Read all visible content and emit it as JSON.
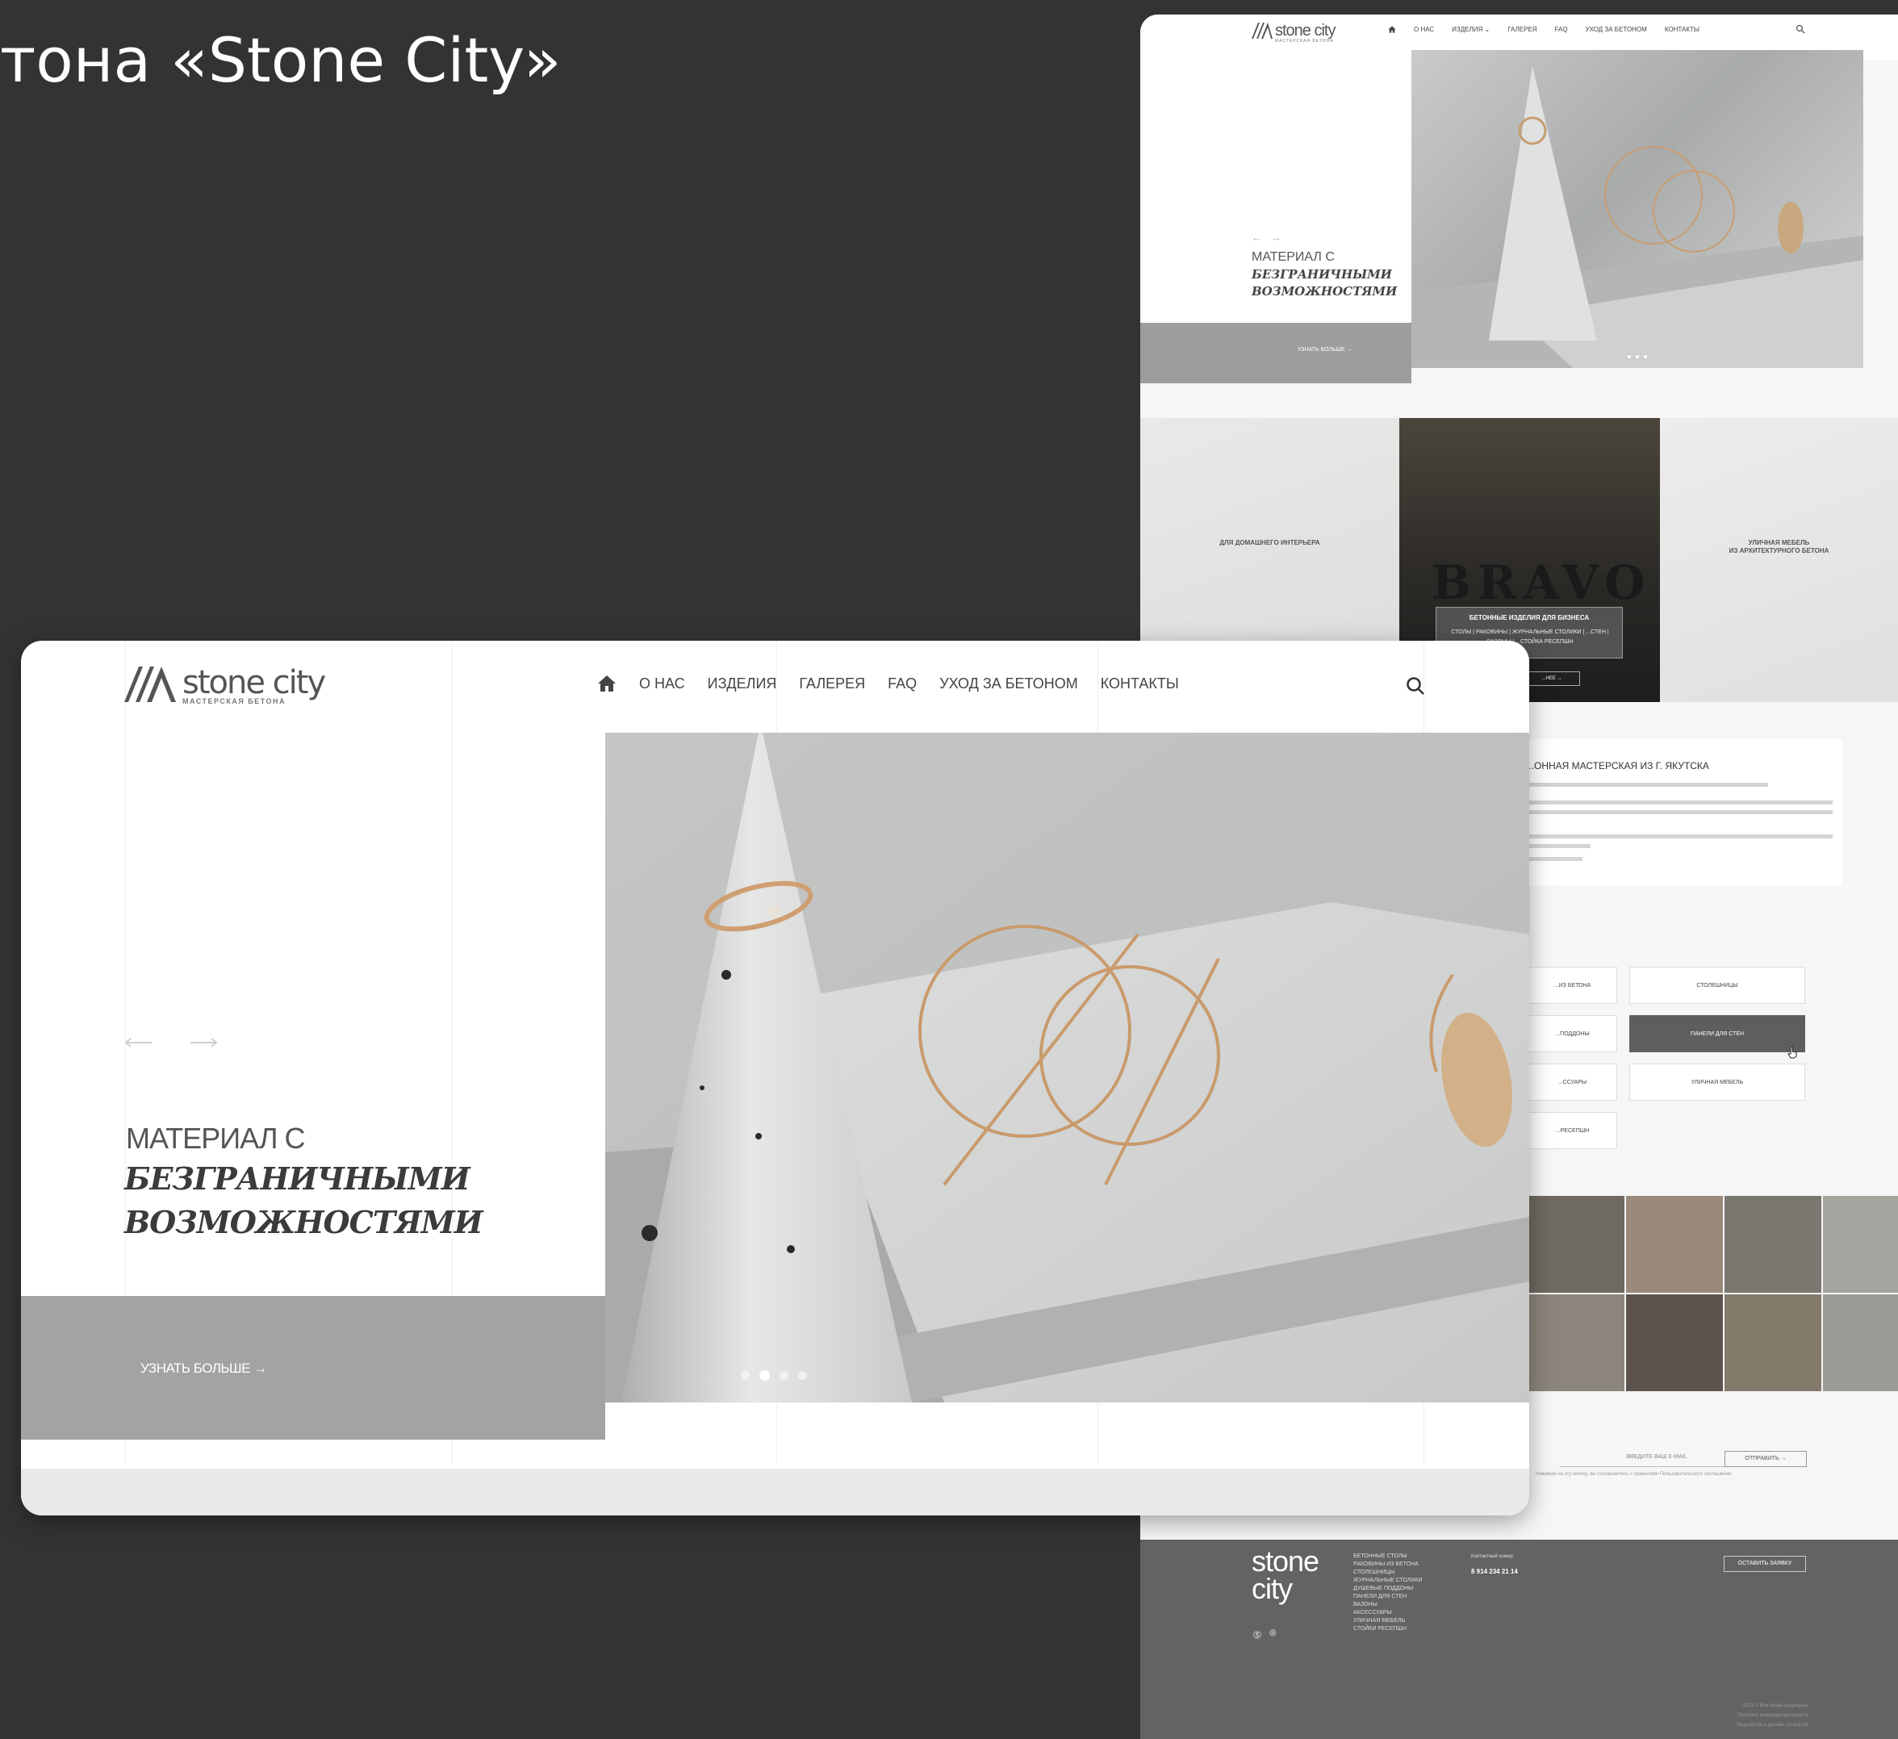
{
  "page_heading": "тона «Stone City»",
  "front": {
    "logo": {
      "name": "stone city",
      "tagline": "МАСТЕРСКАЯ БЕТОНА"
    },
    "nav": [
      {
        "label": "О НАС"
      },
      {
        "label": "ИЗДЕЛИЯ"
      },
      {
        "label": "ГАЛЕРЕЯ"
      },
      {
        "label": "FAQ"
      },
      {
        "label": "УХОД ЗА БЕТОНОМ"
      },
      {
        "label": "КОНТАКТЫ"
      }
    ],
    "hero": {
      "line1": "МАТЕРИАЛ С",
      "line2": "БЕЗГРАНИЧНЫМИ",
      "line3": "ВОЗМОЖНОСТЯМИ",
      "cta": "УЗНАТЬ БОЛЬШЕ →",
      "slides_total": 4,
      "active_slide": 2
    }
  },
  "background_page": {
    "logo": {
      "name": "stone city",
      "tagline": "МАСТЕРСКАЯ БЕТОНА"
    },
    "nav": [
      "О НАС",
      "ИЗДЕЛИЯ ⌄",
      "ГАЛЕРЕЯ",
      "FAQ",
      "УХОД ЗА БЕТОНОМ",
      "КОНТАКТЫ"
    ],
    "hero": {
      "line1": "МАТЕРИАЛ С",
      "line2": "БЕЗГРАНИЧНЫМИ",
      "line3": "ВОЗМОЖНОСТЯМИ",
      "cta": "УЗНАТЬ БОЛЬШЕ →"
    },
    "categories": {
      "home": "ДЛЯ ДОМАШНЕГО ИНТЕРЬЕРА",
      "business_sign": "BRAVO",
      "business": "БЕТОННЫЕ ИЗДЕЛИЯ ДЛЯ БИЗНЕСА",
      "business_items": "СТОЛЫ | РАКОВИНЫ | ЖУРНАЛЬНЫЕ СТОЛИКИ | ...СТЕН | ВАЗОНЫ | ...СТОЙКА РЕСЕПШН",
      "business_more": "...НЕЕ →",
      "outdoor_line1": "УЛИЧНАЯ МЕБЕЛЬ",
      "outdoor_line2": "ИЗ АРХИТЕКТУРНОГО БЕТОНА"
    },
    "about_title": "...ОННАЯ МАСТЕРСКАЯ ИЗ Г. ЯКУТСКА",
    "product_buttons": [
      {
        "label": "...ИЗ БЕТОНА",
        "active": false
      },
      {
        "label": "СТОЛЕШНИЦЫ",
        "active": false
      },
      {
        "label": "...ПОДДОНЫ",
        "active": false
      },
      {
        "label": "ПАНЕЛИ ДЛЯ СТЕН",
        "active": true
      },
      {
        "label": "...ССУАРЫ",
        "active": false
      },
      {
        "label": "УЛИЧНАЯ МЕБЕЛЬ",
        "active": false
      },
      {
        "label": "...РЕСЕПШН",
        "active": false
      }
    ],
    "subscribe": {
      "placeholder": "ВВЕДИТЕ ВАШ E-MAIL",
      "button": "ОТПРАВИТЬ →",
      "note": "Нажимая на эту кнопку, вы соглашаетесь с правилами Пользовательского соглашения"
    },
    "footer": {
      "logo_line1": "stone",
      "logo_line2": "city",
      "links": [
        "БЕТОННЫЕ СТОЛЫ",
        "РАКОВИНЫ ИЗ БЕТОНА",
        "СТОЛЕШНИЦЫ",
        "ЖУРНАЛЬНЫЕ СТОЛИКИ",
        "ДУШЕВЫЕ ПОДДОНЫ",
        "ПАНЕЛИ ДЛЯ СТЕН",
        "ВАЗОНЫ",
        "АКСЕССУАРЫ",
        "УЛИЧНАЯ МЕБЕЛЬ",
        "СТОЙКИ РЕСЕПШН"
      ],
      "contact_label": "Контактный номер",
      "phone": "8 914 234 21 14",
      "cta": "ОСТАВИТЬ ЗАЯВКУ",
      "legal": [
        "2021 © Все права защищены",
        "Политика конфиденциальности",
        "Разработка и дизайн: SmartLink"
      ]
    }
  },
  "colors": {
    "background": "#333333",
    "panel_gray": "#a3a3a2",
    "footer_gray": "#636363",
    "active_button": "#5e5e5e"
  }
}
